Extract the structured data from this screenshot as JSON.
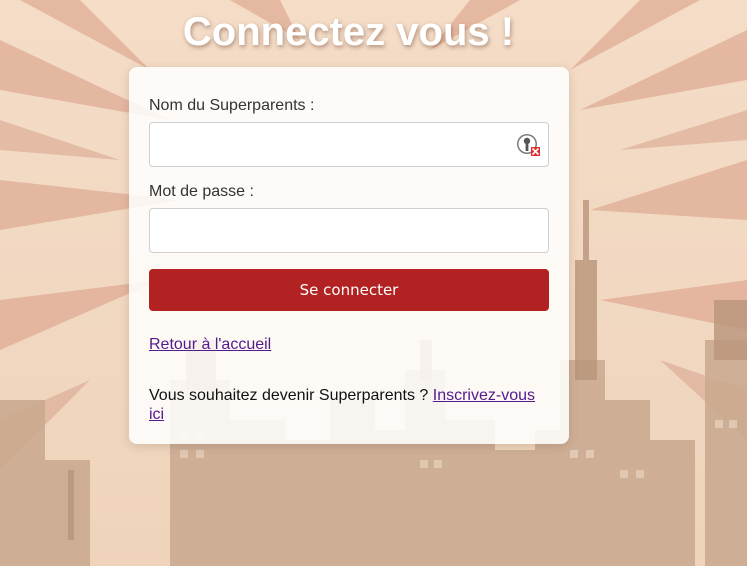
{
  "page": {
    "title": "Connectez vous !"
  },
  "form": {
    "username_label": "Nom du Superparents :",
    "username_value": "",
    "password_label": "Mot de passe :",
    "password_value": "",
    "submit_label": "Se connecter"
  },
  "links": {
    "home": "Retour à l'accueil",
    "signup_prompt": "Vous souhaitez devenir Superparents ?",
    "signup_link": "Inscrivez-vous ici"
  },
  "icons": {
    "username_field_icon": "password-manager-key-icon"
  },
  "colors": {
    "button": "#b22222",
    "link": "#551a8b",
    "title": "#ffffff"
  }
}
